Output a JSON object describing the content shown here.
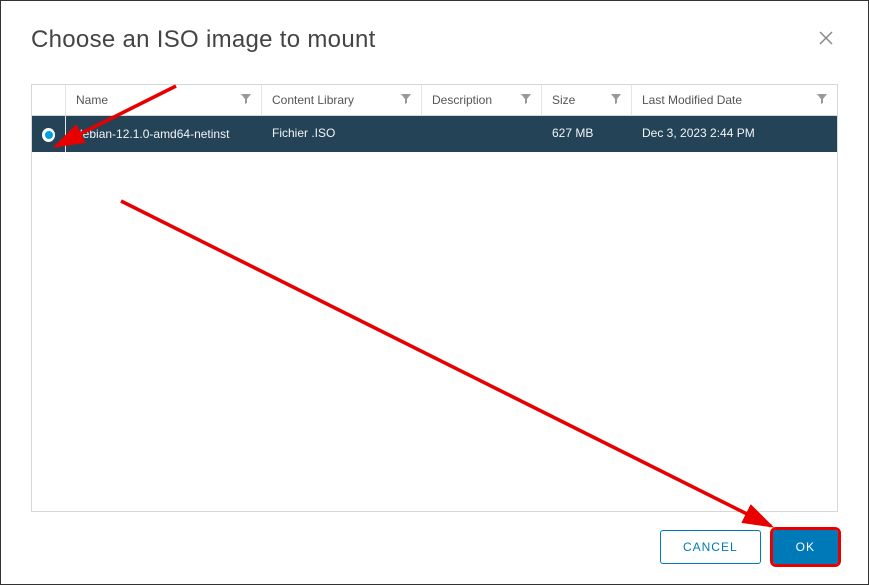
{
  "dialog": {
    "title": "Choose an ISO image to mount"
  },
  "columns": {
    "name": "Name",
    "contentLibrary": "Content Library",
    "description": "Description",
    "size": "Size",
    "lastModified": "Last Modified Date"
  },
  "rows": [
    {
      "selected": true,
      "name": "debian-12.1.0-amd64-netinst",
      "contentLibrary": "Fichier .ISO",
      "description": "",
      "size": "627 MB",
      "lastModified": "Dec 3, 2023 2:44 PM"
    }
  ],
  "buttons": {
    "cancel": "CANCEL",
    "ok": "OK"
  }
}
